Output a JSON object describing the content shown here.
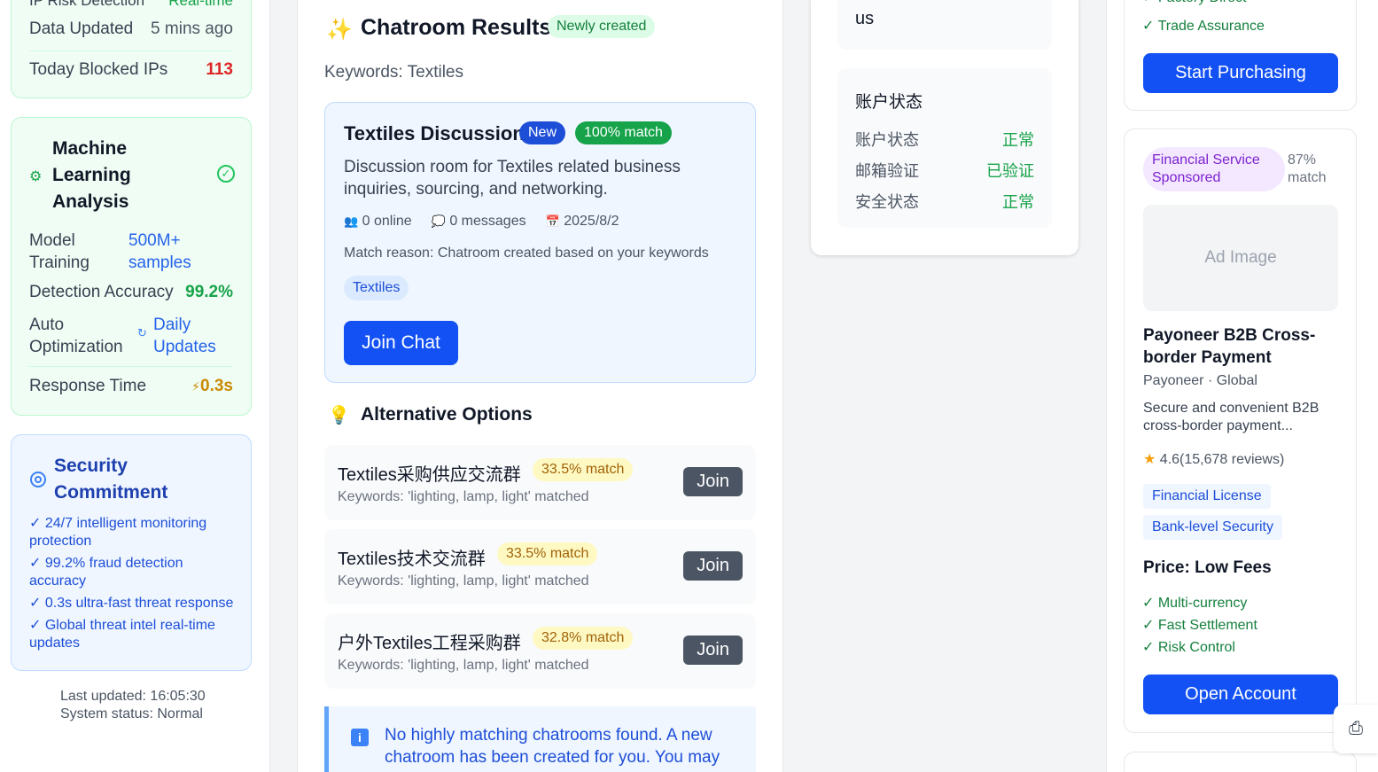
{
  "left": {
    "top_card": {
      "cut_label": "IP Risk Detection",
      "cut_value": "Real-time",
      "rows": [
        {
          "label": "Data Updated",
          "value": "5 mins ago"
        },
        {
          "label": "Today Blocked IPs",
          "value": "113"
        }
      ]
    },
    "ml_card": {
      "title": "Machine Learning Analysis",
      "rows": [
        {
          "label": "Model Training",
          "value": "500M+ samples"
        },
        {
          "label": "Detection Accuracy",
          "value": "99.2%"
        },
        {
          "label": "Auto Optimization",
          "value": "Daily Updates"
        },
        {
          "label": "Response Time",
          "value": "0.3s"
        }
      ]
    },
    "security": {
      "title": "Security Commitment",
      "items": [
        "✓ 24/7 intelligent monitoring protection",
        "✓ 99.2% fraud detection accuracy",
        "✓ 0.3s ultra-fast threat response",
        "✓ Global threat intel real-time updates"
      ]
    },
    "footer": {
      "updated": "Last updated: 16:05:30",
      "status": "System status: Normal"
    }
  },
  "main": {
    "title": "Chatroom Results",
    "badge": "Newly created",
    "keywords": "Keywords: Textiles",
    "room": {
      "name": "Textiles Discussion",
      "new_badge": "New",
      "match_badge": "100% match",
      "description": "Discussion room for Textiles related business inquiries, sourcing, and networking.",
      "online": "0 online",
      "messages": "0 messages",
      "date": "2025/8/2",
      "reason": "Match reason: Chatroom created based on your keywords",
      "tag": "Textiles",
      "join_label": "Join Chat"
    },
    "alt_title": "Alternative Options",
    "alternatives": [
      {
        "name": "Textiles采购供应交流群",
        "match": "33.5% match",
        "keywords": "Keywords: 'lighting, lamp, light' matched",
        "join": "Join"
      },
      {
        "name": "Textiles技术交流群",
        "match": "33.5% match",
        "keywords": "Keywords: 'lighting, lamp, light' matched",
        "join": "Join"
      },
      {
        "name": "户外Textiles工程采购群",
        "match": "32.8% match",
        "keywords": "Keywords: 'lighting, lamp, light' matched",
        "join": "Join"
      }
    ],
    "info": "No highly matching chatrooms found. A new chatroom has been created for you. You may"
  },
  "mid": {
    "top_text": "us",
    "account": {
      "title": "账户状态",
      "rows": [
        {
          "label": "账户状态",
          "value": "正常"
        },
        {
          "label": "邮箱验证",
          "value": "已验证"
        },
        {
          "label": "安全状态",
          "value": "正常"
        }
      ]
    }
  },
  "right": {
    "ad1": {
      "checks": [
        "✓ Factory Direct",
        "✓ Trade Assurance"
      ],
      "cta": "Start Purchasing"
    },
    "ad2": {
      "badge": "Financial Service Sponsored",
      "match": "87% match",
      "image_label": "Ad Image",
      "title": "Payoneer B2B Cross-border Payment",
      "company": "Payoneer · Global",
      "description": "Secure and convenient B2B cross-border payment...",
      "rating": "4.6(15,678 reviews)",
      "tags": [
        "Financial License",
        "Bank-level Security"
      ],
      "price": "Price: Low Fees",
      "checks": [
        "✓ Multi-currency",
        "✓ Fast Settlement",
        "✓ Risk Control"
      ],
      "cta": "Open Account"
    }
  }
}
